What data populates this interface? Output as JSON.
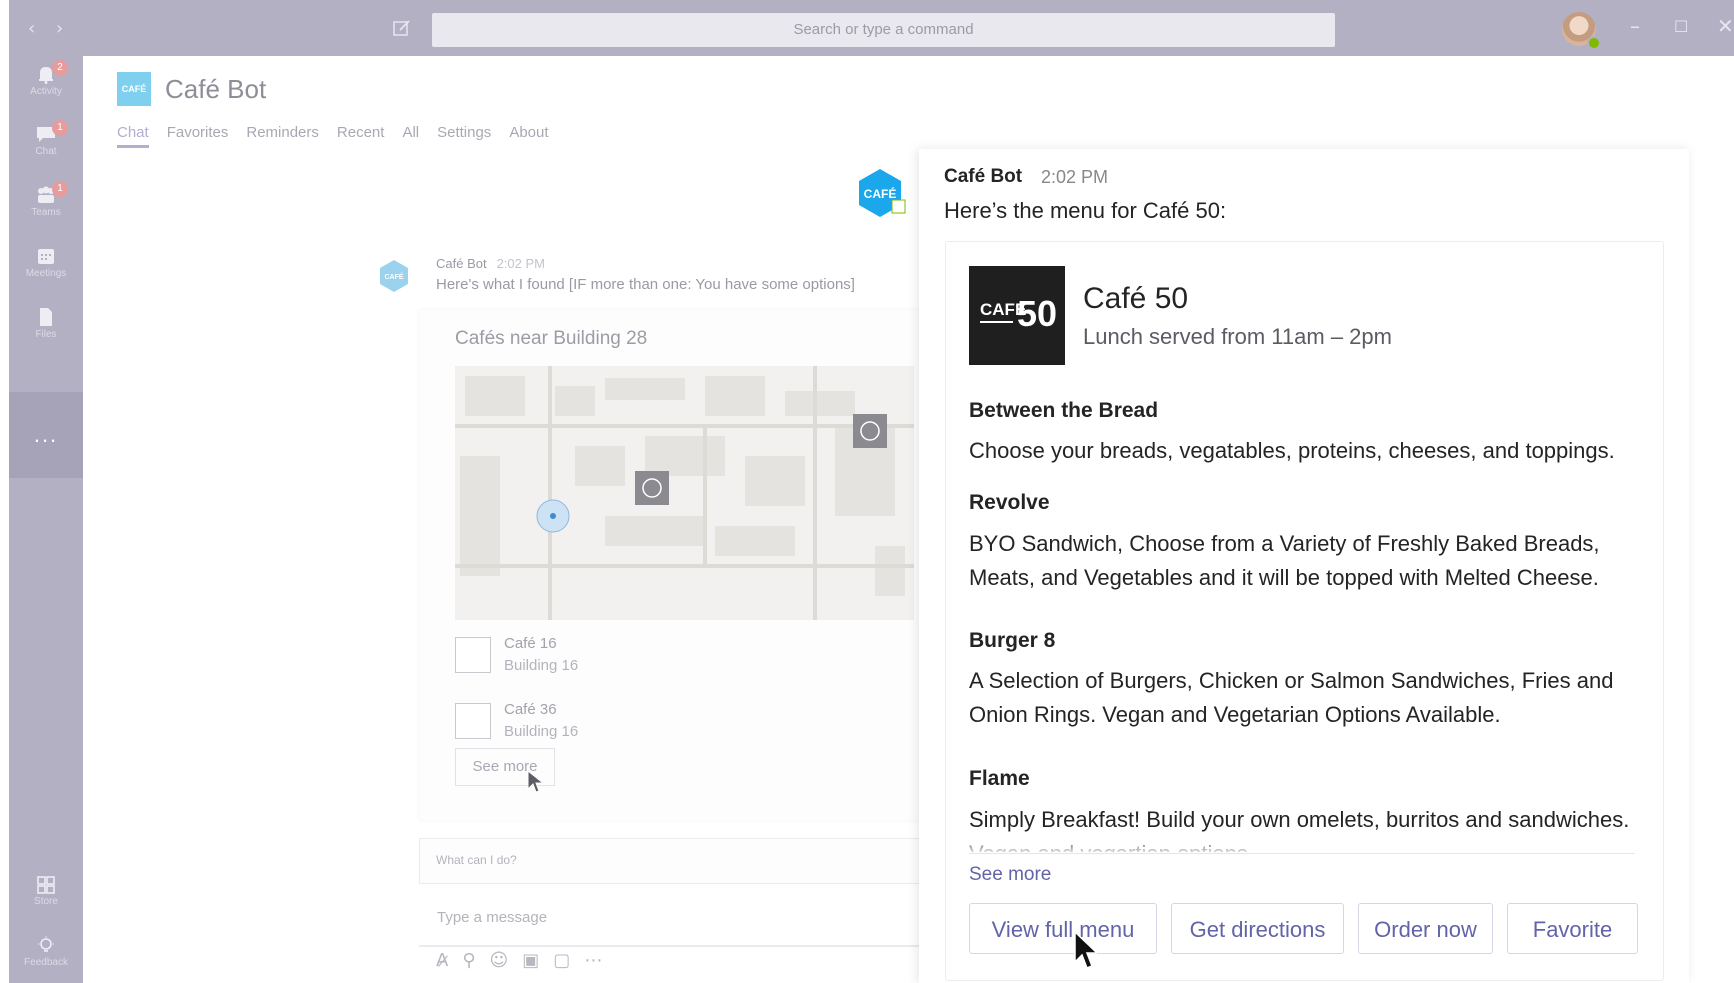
{
  "topbar": {
    "back_icon": "chevron-left-icon",
    "forward_icon": "chevron-right-icon",
    "compose_icon": "compose-icon",
    "search_placeholder": "Search or type a command"
  },
  "rail": {
    "items": [
      {
        "label": "Activity",
        "icon": "bell-icon",
        "badge": "2"
      },
      {
        "label": "Chat",
        "icon": "chat-icon",
        "badge": "1"
      },
      {
        "label": "Teams",
        "icon": "teams-icon",
        "badge": "1"
      },
      {
        "label": "Meetings",
        "icon": "calendar-icon",
        "badge": ""
      },
      {
        "label": "Files",
        "icon": "file-icon",
        "badge": ""
      }
    ],
    "more": "...",
    "bottom": [
      {
        "label": "Store",
        "icon": "store-icon"
      },
      {
        "label": "Feedback",
        "icon": "lightbulb-icon"
      }
    ]
  },
  "header": {
    "logo_text": "CAFÉ",
    "title": "Café Bot",
    "tabs": [
      "Chat",
      "Favorites",
      "Reminders",
      "Recent",
      "All",
      "Settings",
      "About"
    ],
    "active_tab": "Chat"
  },
  "background_chat": {
    "avatar_text": "CAFÉ",
    "sender": "Café Bot",
    "time": "2:02 PM",
    "message": "Here's what I found [IF more than one: You have some options]",
    "card_title": "Cafés near Building 28",
    "cafes": [
      {
        "name": "Café 16",
        "building": "Building 16"
      },
      {
        "name": "Café 36",
        "building": "Building 16"
      }
    ],
    "see_more": "See more",
    "ask_placeholder": "What can I do?",
    "compose_placeholder": "Type a message"
  },
  "foreground": {
    "sender": "Café Bot",
    "time": "2:02 PM",
    "message": "Here’s the menu for Café 50:",
    "logo": {
      "small": "CAFE",
      "big": "50"
    },
    "cafe_title": "Café 50",
    "hours": "Lunch served from 11am – 2pm",
    "sections": [
      {
        "title": "Between the Bread",
        "body": "Choose your breads, vegatables, proteins, cheeses, and toppings."
      },
      {
        "title": "Revolve",
        "body": "BYO Sandwich, Choose from a Variety of Freshly Baked Breads, Meats, and Vegetables and it will be topped with Melted Cheese."
      },
      {
        "title": "Burger 8",
        "body": "A Selection of Burgers, Chicken or Salmon Sandwiches, Fries and Onion Rings. Vegan and Vegetarian Options Available."
      },
      {
        "title": "Flame",
        "body": "Simply Breakfast! Build your own omelets, burritos and sandwiches. Vegan and vegartian options"
      }
    ],
    "see_more": "See more",
    "buttons": [
      "View full menu",
      "Get directions",
      "Order now",
      "Favorite"
    ]
  },
  "colors": {
    "accent": "#6264a7",
    "rail": "#b3b0c4",
    "bot_blue": "#00a2ed"
  }
}
